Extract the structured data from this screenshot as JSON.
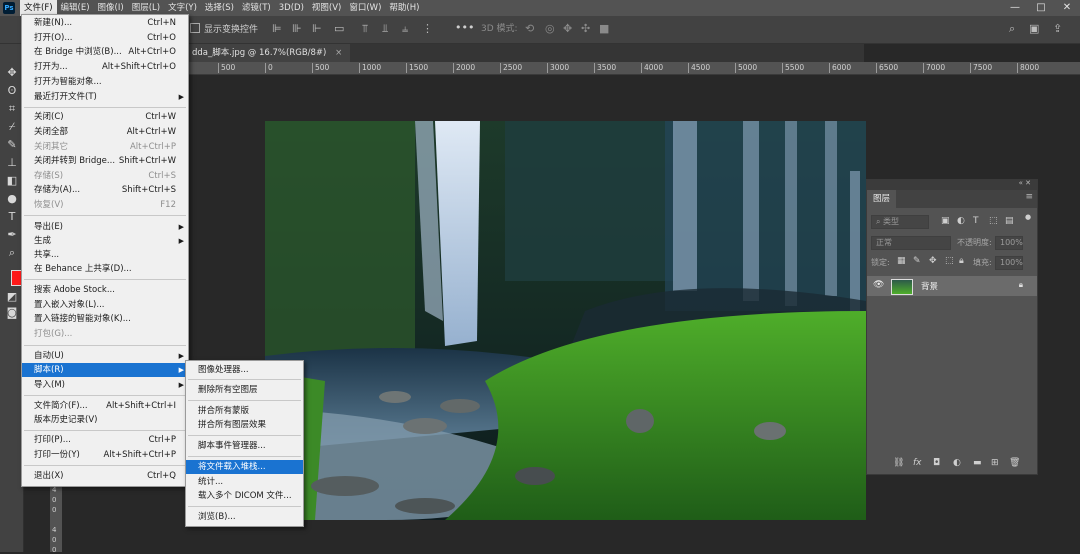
{
  "menubar": {
    "logo": "Ps",
    "items": [
      "文件(F)",
      "编辑(E)",
      "图像(I)",
      "图层(L)",
      "文字(Y)",
      "选择(S)",
      "滤镜(T)",
      "3D(D)",
      "视图(V)",
      "窗口(W)",
      "帮助(H)"
    ],
    "window_controls": [
      "—",
      "□",
      "✕"
    ]
  },
  "options": {
    "show_transform": "显示变换控件",
    "mode_3d": "3D 模式:",
    "more": "•••"
  },
  "document": {
    "tab_title": "dda_脚本.jpg @ 16.7%(RGB/8#)",
    "tab_close": "×"
  },
  "ruler": {
    "top": [
      "500",
      "0",
      "500",
      "1000",
      "1500",
      "2000",
      "2500",
      "3000",
      "3500",
      "4000",
      "4500",
      "5000",
      "5500",
      "6000",
      "6500",
      "7000",
      "7500",
      "8000"
    ],
    "left": [
      "4",
      "0",
      "0",
      "4",
      "0",
      "0"
    ]
  },
  "file_menu": {
    "items": [
      {
        "label": "新建(N)...",
        "shortcut": "Ctrl+N"
      },
      {
        "label": "打开(O)...",
        "shortcut": "Ctrl+O"
      },
      {
        "label": "在 Bridge 中浏览(B)...",
        "shortcut": "Alt+Ctrl+O"
      },
      {
        "label": "打开为...",
        "shortcut": "Alt+Shift+Ctrl+O"
      },
      {
        "label": "打开为智能对象...",
        "shortcut": ""
      },
      {
        "label": "最近打开文件(T)",
        "shortcut": "",
        "arrow": "▶"
      },
      {
        "label": "关闭(C)",
        "shortcut": "Ctrl+W"
      },
      {
        "label": "关闭全部",
        "shortcut": "Alt+Ctrl+W"
      },
      {
        "label": "关闭其它",
        "shortcut": "Alt+Ctrl+P"
      },
      {
        "label": "关闭并转到 Bridge...",
        "shortcut": "Shift+Ctrl+W"
      },
      {
        "label": "存储(S)",
        "shortcut": "Ctrl+S"
      },
      {
        "label": "存储为(A)...",
        "shortcut": "Shift+Ctrl+S"
      },
      {
        "label": "恢复(V)",
        "shortcut": "F12"
      },
      {
        "label": "导出(E)",
        "shortcut": "",
        "arrow": "▶"
      },
      {
        "label": "生成",
        "shortcut": "",
        "arrow": "▶"
      },
      {
        "label": "共享...",
        "shortcut": ""
      },
      {
        "label": "在 Behance 上共享(D)...",
        "shortcut": ""
      },
      {
        "label": "搜索 Adobe Stock...",
        "shortcut": ""
      },
      {
        "label": "置入嵌入对象(L)...",
        "shortcut": ""
      },
      {
        "label": "置入链接的智能对象(K)...",
        "shortcut": ""
      },
      {
        "label": "打包(G)...",
        "shortcut": ""
      },
      {
        "label": "自动(U)",
        "shortcut": "",
        "arrow": "▶"
      },
      {
        "label": "脚本(R)",
        "shortcut": "",
        "arrow": "▶"
      },
      {
        "label": "导入(M)",
        "shortcut": "",
        "arrow": "▶"
      },
      {
        "label": "文件简介(F)...",
        "shortcut": "Alt+Shift+Ctrl+I"
      },
      {
        "label": "版本历史记录(V)",
        "shortcut": ""
      },
      {
        "label": "打印(P)...",
        "shortcut": "Ctrl+P"
      },
      {
        "label": "打印一份(Y)",
        "shortcut": "Alt+Shift+Ctrl+P"
      },
      {
        "label": "退出(X)",
        "shortcut": "Ctrl+Q"
      }
    ]
  },
  "scripts_menu": {
    "items": [
      "图像处理器...",
      "删除所有空图层",
      "拼合所有蒙版",
      "拼合所有图层效果",
      "脚本事件管理器...",
      "将文件载入堆栈...",
      "统计...",
      "载入多个 DICOM 文件...",
      "浏览(B)..."
    ]
  },
  "layers_panel": {
    "tab": "图层",
    "filter_kind": "类型",
    "blend_mode": "正常",
    "opacity_label": "不透明度:",
    "opacity_value": "100%",
    "lock_label": "锁定:",
    "fill_label": "填充:",
    "fill_value": "100%",
    "layer_name": "背景"
  }
}
